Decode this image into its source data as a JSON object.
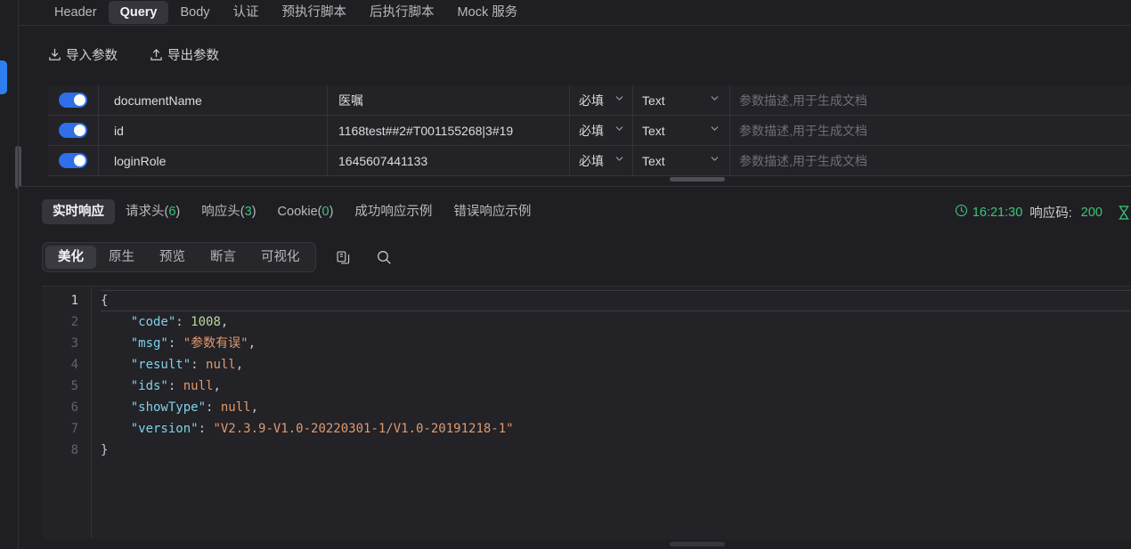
{
  "request_tabs": [
    {
      "label": "Header",
      "active": false
    },
    {
      "label": "Query",
      "active": true
    },
    {
      "label": "Body",
      "active": false
    },
    {
      "label": "认证",
      "active": false
    },
    {
      "label": "预执行脚本",
      "active": false
    },
    {
      "label": "后执行脚本",
      "active": false
    },
    {
      "label": "Mock 服务",
      "active": false
    }
  ],
  "toolbar": {
    "import_label": "导入参数",
    "export_label": "导出参数"
  },
  "param_table": {
    "rows": [
      {
        "enabled": true,
        "name": "documentName",
        "value": "医嘱",
        "required": "必填",
        "type": "Text",
        "desc_placeholder": "参数描述,用于生成文档"
      },
      {
        "enabled": true,
        "name": "id",
        "value": "1168test##2#T001155268|3#19",
        "required": "必填",
        "type": "Text",
        "desc_placeholder": "参数描述,用于生成文档"
      },
      {
        "enabled": true,
        "name": "loginRole",
        "value": "1645607441133",
        "required": "必填",
        "type": "Text",
        "desc_placeholder": "参数描述,用于生成文档"
      }
    ]
  },
  "response": {
    "tabs": [
      {
        "label": "实时响应",
        "count": null,
        "active": true
      },
      {
        "label": "请求头",
        "count": "6",
        "active": false
      },
      {
        "label": "响应头",
        "count": "3",
        "active": false
      },
      {
        "label": "Cookie",
        "count": "0",
        "active": false
      },
      {
        "label": "成功响应示例",
        "count": null,
        "active": false
      },
      {
        "label": "错误响应示例",
        "count": null,
        "active": false
      }
    ],
    "status": {
      "time": "16:21:30",
      "code_label": "响应码:",
      "code_value": "200",
      "clock_icon": "clock-icon",
      "hourglass_icon": "hourglass-icon"
    },
    "viewer_tabs": [
      {
        "label": "美化",
        "active": true
      },
      {
        "label": "原生",
        "active": false
      },
      {
        "label": "预览",
        "active": false
      },
      {
        "label": "断言",
        "active": false
      },
      {
        "label": "可视化",
        "active": false
      }
    ],
    "viewer_actions": [
      {
        "icon": "copy-icon"
      },
      {
        "icon": "search-icon"
      }
    ]
  },
  "code": {
    "language": "json",
    "line_numbers": [
      "1",
      "2",
      "3",
      "4",
      "5",
      "6",
      "7",
      "8"
    ],
    "current_line": 1,
    "body": {
      "code": 1008,
      "msg": "参数有误",
      "result": null,
      "ids": null,
      "showType": null,
      "version": "V2.3.9-V1.0-20220301-1/V1.0-20191218-1"
    },
    "lines": [
      {
        "indent": 0,
        "tokens": [
          {
            "t": "{",
            "c": "p"
          }
        ]
      },
      {
        "indent": 1,
        "tokens": [
          {
            "t": "\"code\"",
            "c": "k"
          },
          {
            "t": ": ",
            "c": "p"
          },
          {
            "t": "1008",
            "c": "n"
          },
          {
            "t": ",",
            "c": "p"
          }
        ]
      },
      {
        "indent": 1,
        "tokens": [
          {
            "t": "\"msg\"",
            "c": "k"
          },
          {
            "t": ": ",
            "c": "p"
          },
          {
            "t": "\"参数有误\"",
            "c": "s"
          },
          {
            "t": ",",
            "c": "p"
          }
        ]
      },
      {
        "indent": 1,
        "tokens": [
          {
            "t": "\"result\"",
            "c": "k"
          },
          {
            "t": ": ",
            "c": "p"
          },
          {
            "t": "null",
            "c": "nl"
          },
          {
            "t": ",",
            "c": "p"
          }
        ]
      },
      {
        "indent": 1,
        "tokens": [
          {
            "t": "\"ids\"",
            "c": "k"
          },
          {
            "t": ": ",
            "c": "p"
          },
          {
            "t": "null",
            "c": "nl"
          },
          {
            "t": ",",
            "c": "p"
          }
        ]
      },
      {
        "indent": 1,
        "tokens": [
          {
            "t": "\"showType\"",
            "c": "k"
          },
          {
            "t": ": ",
            "c": "p"
          },
          {
            "t": "null",
            "c": "nl"
          },
          {
            "t": ",",
            "c": "p"
          }
        ]
      },
      {
        "indent": 1,
        "tokens": [
          {
            "t": "\"version\"",
            "c": "k"
          },
          {
            "t": ": ",
            "c": "p"
          },
          {
            "t": "\"V2.3.9-V1.0-20220301-1/V1.0-20191218-1\"",
            "c": "s"
          }
        ]
      },
      {
        "indent": 0,
        "tokens": [
          {
            "t": "}",
            "c": "p"
          }
        ]
      }
    ]
  },
  "colors": {
    "accent_blue": "#2f7ef0",
    "success_green": "#3ec47a",
    "panel_bg": "#1f1f23",
    "row_bg": "#222227",
    "border": "#303035",
    "json_key": "#7fd3e8",
    "json_string": "#e09a6e",
    "json_number": "#b9d99a"
  }
}
